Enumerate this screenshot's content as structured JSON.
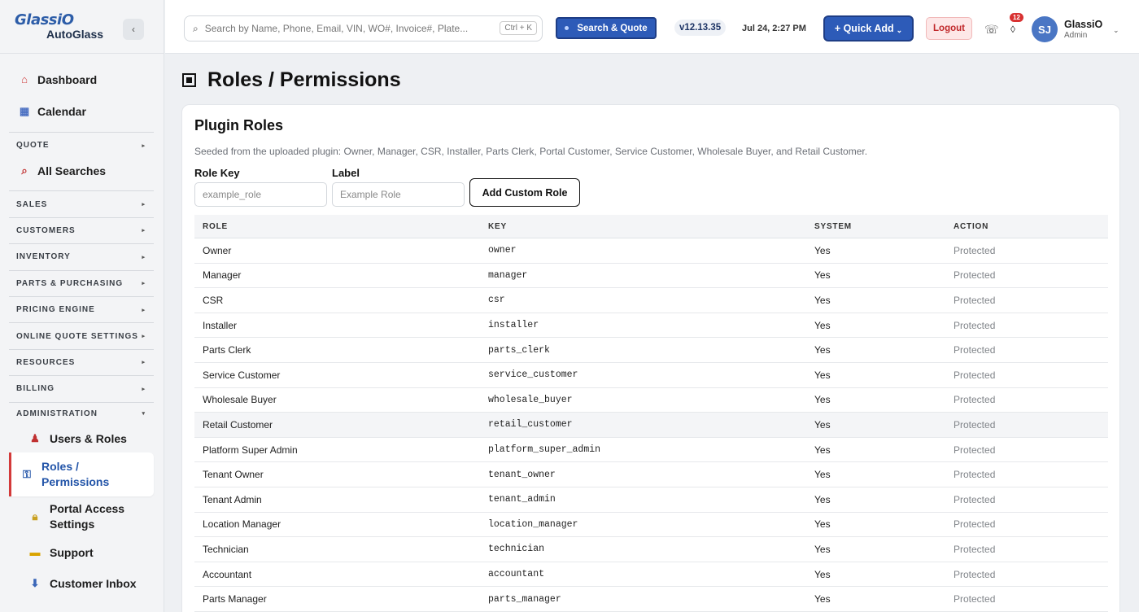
{
  "brand": {
    "name": "GlassiO",
    "sub": "AutoGlass"
  },
  "sidebar": {
    "collapse_glyph": "‹",
    "top_items": [
      {
        "label": "Dashboard",
        "icon": "home-icon"
      },
      {
        "label": "Calendar",
        "icon": "calendar-icon"
      }
    ],
    "quote_group": "QUOTE",
    "all_searches": "All Searches",
    "groups": [
      "SALES",
      "CUSTOMERS",
      "INVENTORY",
      "PARTS & PURCHASING",
      "PRICING ENGINE",
      "ONLINE QUOTE SETTINGS",
      "RESOURCES",
      "BILLING",
      "ADMINISTRATION"
    ],
    "admin_items": [
      {
        "label": "Users & Roles",
        "icon": "user-icon"
      },
      {
        "label_1": "Roles /",
        "label_2": "Permissions",
        "icon": "key-icon",
        "active": true
      },
      {
        "label_1": "Portal Access",
        "label_2": "Settings",
        "icon": "lock-icon"
      },
      {
        "label": "Support",
        "icon": "ticket-icon"
      },
      {
        "label": "Customer Inbox",
        "icon": "inbox-icon"
      }
    ]
  },
  "topbar": {
    "search_placeholder": "Search by Name, Phone, Email, VIN, WO#, Invoice#, Plate...",
    "search_shortcut": "Ctrl + K",
    "search_quote_label": "Search & Quote",
    "version": "v12.13.35",
    "datetime": "Jul 24, 2:27 PM",
    "quick_add_label": "+ Quick Add",
    "logout_label": "Logout",
    "notification_count": "12",
    "user_initials": "SJ",
    "user_name": "GlassiO",
    "user_role": "Admin"
  },
  "page": {
    "title": "Roles / Permissions"
  },
  "card": {
    "title": "Plugin Roles",
    "description": "Seeded from the uploaded plugin: Owner, Manager, CSR, Installer, Parts Clerk, Portal Customer, Service Customer, Wholesale Buyer, and Retail Customer.",
    "role_key_label": "Role Key",
    "role_key_placeholder": "example_role",
    "label_label": "Label",
    "label_placeholder": "Example Role",
    "add_button": "Add Custom Role"
  },
  "table": {
    "headers": [
      "ROLE",
      "KEY",
      "SYSTEM",
      "ACTION"
    ],
    "rows": [
      {
        "role": "Owner",
        "key": "owner",
        "system": "Yes",
        "action": "Protected"
      },
      {
        "role": "Manager",
        "key": "manager",
        "system": "Yes",
        "action": "Protected"
      },
      {
        "role": "CSR",
        "key": "csr",
        "system": "Yes",
        "action": "Protected"
      },
      {
        "role": "Installer",
        "key": "installer",
        "system": "Yes",
        "action": "Protected"
      },
      {
        "role": "Parts Clerk",
        "key": "parts_clerk",
        "system": "Yes",
        "action": "Protected"
      },
      {
        "role": "Service Customer",
        "key": "service_customer",
        "system": "Yes",
        "action": "Protected"
      },
      {
        "role": "Wholesale Buyer",
        "key": "wholesale_buyer",
        "system": "Yes",
        "action": "Protected"
      },
      {
        "role": "Retail Customer",
        "key": "retail_customer",
        "system": "Yes",
        "action": "Protected"
      },
      {
        "role": "Platform Super Admin",
        "key": "platform_super_admin",
        "system": "Yes",
        "action": "Protected"
      },
      {
        "role": "Tenant Owner",
        "key": "tenant_owner",
        "system": "Yes",
        "action": "Protected"
      },
      {
        "role": "Tenant Admin",
        "key": "tenant_admin",
        "system": "Yes",
        "action": "Protected"
      },
      {
        "role": "Location Manager",
        "key": "location_manager",
        "system": "Yes",
        "action": "Protected"
      },
      {
        "role": "Technician",
        "key": "technician",
        "system": "Yes",
        "action": "Protected"
      },
      {
        "role": "Accountant",
        "key": "accountant",
        "system": "Yes",
        "action": "Protected"
      },
      {
        "role": "Parts Manager",
        "key": "parts_manager",
        "system": "Yes",
        "action": "Protected"
      }
    ]
  }
}
